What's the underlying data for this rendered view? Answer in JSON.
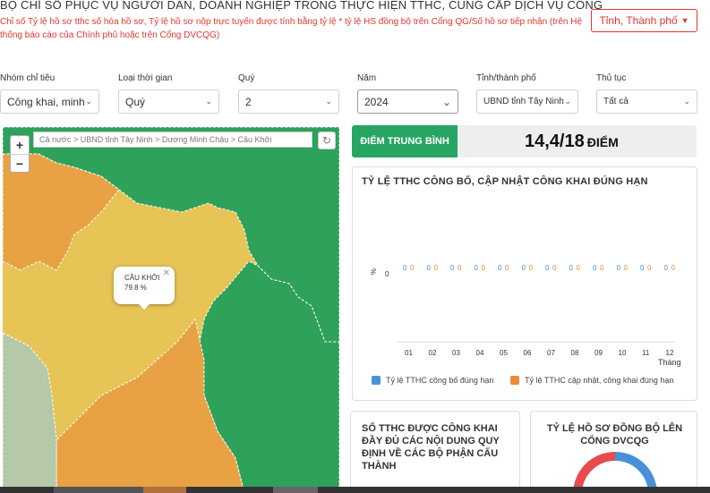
{
  "header": {
    "title": "BỘ CHỈ SỐ PHỤC VỤ NGƯỜI DÂN, DOANH NGHIỆP TRONG THỰC HIỆN TTHC, CUNG CẤP DỊCH VỤ CÔNG",
    "subtitle": "Chỉ số Tỷ lệ hồ sơ tthc số hóa hồ sơ, Tỷ lệ hồ sơ nộp trực tuyến được tính bằng tỷ lệ * tỷ lệ HS đồng bộ trên Cổng QG/Số hồ sơ tiếp nhận (trên Hệ thống báo cáo của Chính phủ hoặc trên Cổng DVCQG)",
    "province_button": "Tỉnh, Thành phố"
  },
  "filters": {
    "group": {
      "label": "Nhóm chỉ tiêu",
      "value": "Công khai, minh"
    },
    "time_type": {
      "label": "Loại thời gian",
      "value": "Quý"
    },
    "quarter": {
      "label": "Quý",
      "value": "2"
    },
    "year": {
      "label": "Năm",
      "value": "2024"
    },
    "province": {
      "label": "Tỉnh/thành phố",
      "value": "UBND tỉnh Tây Ninh"
    },
    "procedure": {
      "label": "Thủ tục",
      "value": "Tất cả"
    }
  },
  "map": {
    "zoom_in": "+",
    "zoom_out": "−",
    "breadcrumb": "Cả nước > UBND tỉnh Tây Ninh > Dương Minh Châu > Cầu Khởi",
    "popup": {
      "name": "CẦU KHỞI",
      "value": "79.8 %"
    },
    "colors": {
      "green": "#2ea15a",
      "yellow": "#e4c553",
      "orange": "#e8a244",
      "gray": "#b5c8a8"
    }
  },
  "score": {
    "label": "ĐIỂM TRUNG BÌNH",
    "value": "14,4/18",
    "unit": "ĐIỂM"
  },
  "chart_data": {
    "type": "bar",
    "title": "TỶ LỆ TTHC CÔNG BỐ, CẬP NHẬT CÔNG KHAI ĐÚNG HẠN",
    "categories": [
      "01",
      "02",
      "03",
      "04",
      "05",
      "06",
      "07",
      "08",
      "09",
      "10",
      "11",
      "12"
    ],
    "xlabel": "Tháng",
    "ylabel": "%",
    "y_tick": "0",
    "series": [
      {
        "name": "Tỷ lệ TTHC công bố đúng hạn",
        "color": "#4a90d9",
        "values": [
          0,
          0,
          0,
          0,
          0,
          0,
          0,
          0,
          0,
          0,
          0,
          0
        ]
      },
      {
        "name": "Tỷ lệ TTHC cập nhật, công khai đúng hạn",
        "color": "#ea8a3a",
        "values": [
          0,
          0,
          0,
          0,
          0,
          0,
          0,
          0,
          0,
          0,
          0,
          0
        ]
      }
    ]
  },
  "cards": {
    "published": "SỐ TTHC ĐƯỢC CÔNG KHAI ĐẦY ĐỦ CÁC NỘI DUNG QUY ĐỊNH VỀ CÁC BỘ PHẬN CẤU THÀNH",
    "sync": "TỶ LỆ HỒ SƠ ĐỒNG BỘ LÊN CỔNG DVCQG"
  }
}
